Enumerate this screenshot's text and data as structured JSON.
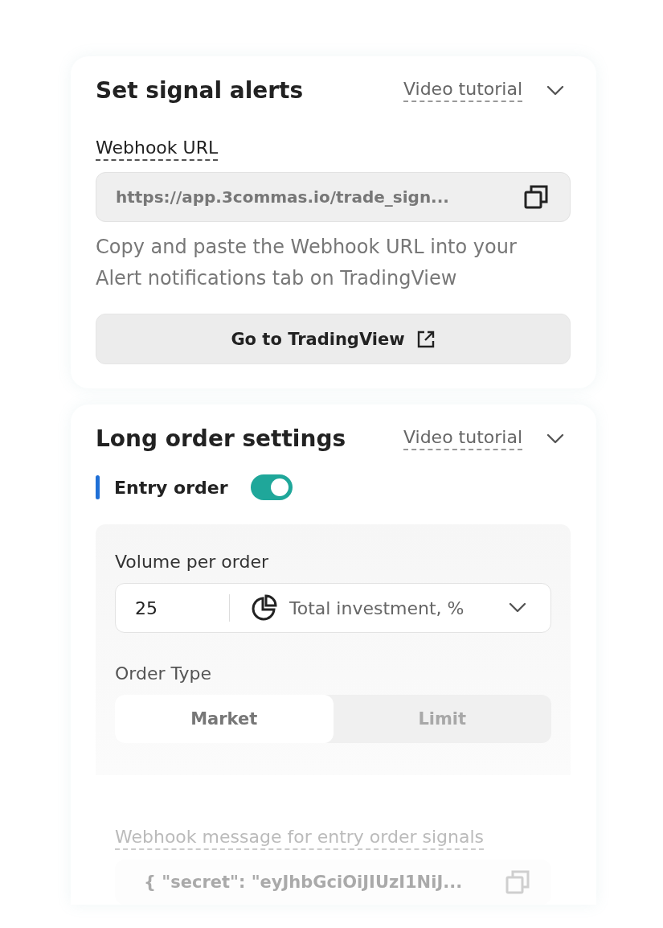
{
  "signal_alerts": {
    "title": "Set signal alerts",
    "tutorial_link": "Video tutorial",
    "webhook_url": {
      "label": "Webhook URL",
      "value": "https://app.3commas.io/trade_sign..."
    },
    "help_text": "Copy and paste the Webhook URL into your Alert notifications tab on TradingView",
    "button": "Go to TradingView"
  },
  "long_order_settings": {
    "title": "Long order settings",
    "tutorial_link": "Video tutorial",
    "entry_order": {
      "label": "Entry order",
      "on": true
    },
    "volume_per_order": {
      "label": "Volume per order",
      "value": "25",
      "unit": "Total investment, %"
    },
    "order_type": {
      "label": "Order Type",
      "options": [
        {
          "label": "Market",
          "selected": true
        },
        {
          "label": "Limit",
          "selected": false
        }
      ]
    },
    "webhook_message": {
      "label": "Webhook message for entry order signals",
      "value": "{ \"secret\": \"eyJhbGciOiJIUzI1NiJ..."
    }
  }
}
